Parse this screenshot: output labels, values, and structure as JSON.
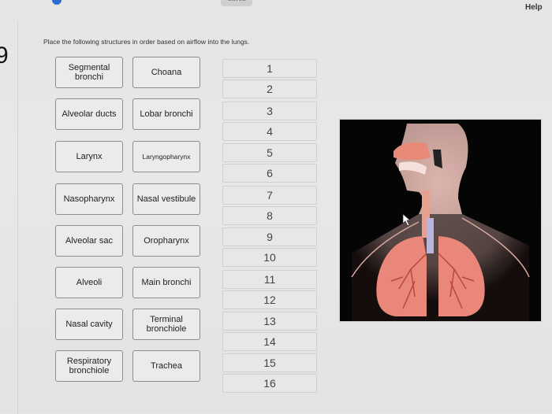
{
  "header": {
    "saved_label": "Saved",
    "help_label": "Help"
  },
  "question": {
    "number": "9",
    "prompt": "Place the following structures in order based on airflow into the lungs."
  },
  "items": [
    {
      "label": "Segmental bronchi"
    },
    {
      "label": "Choana"
    },
    {
      "label": "Alveolar ducts"
    },
    {
      "label": "Lobar bronchi"
    },
    {
      "label": "Larynx"
    },
    {
      "label": "Laryngopharynx"
    },
    {
      "label": "Nasopharynx"
    },
    {
      "label": "Nasal vestibule"
    },
    {
      "label": "Alveolar sac"
    },
    {
      "label": "Oropharynx"
    },
    {
      "label": "Alveoli"
    },
    {
      "label": "Main bronchi"
    },
    {
      "label": "Nasal cavity"
    },
    {
      "label": "Terminal bronchiole"
    },
    {
      "label": "Respiratory bronchiole"
    },
    {
      "label": "Trachea"
    }
  ],
  "slots": [
    "1",
    "2",
    "3",
    "4",
    "5",
    "6",
    "7",
    "8",
    "9",
    "10",
    "11",
    "12",
    "13",
    "14",
    "15",
    "16"
  ],
  "figure": {
    "alt": "respiratory-system-diagram"
  }
}
